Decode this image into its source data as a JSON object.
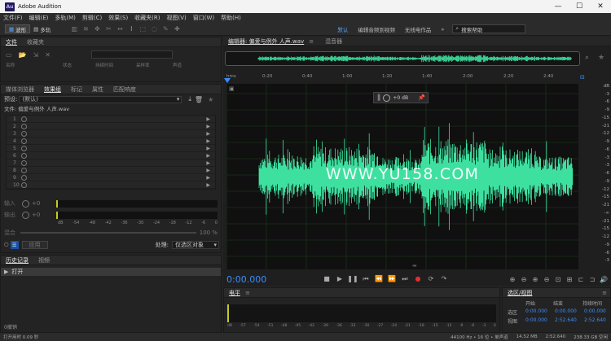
{
  "window": {
    "title": "Adobe Audition",
    "logo": "Au",
    "min": "—",
    "max": "☐",
    "close": "✕"
  },
  "menu": [
    "文件(F)",
    "编辑(E)",
    "多轨(M)",
    "剪辑(C)",
    "效果(S)",
    "收藏夹(R)",
    "视图(V)",
    "窗口(W)",
    "帮助(H)"
  ],
  "toolbar": {
    "waveform": "波形",
    "multitrack": "多轨",
    "workspaces": [
      "默认",
      "编辑音频到视频",
      "无线电作品"
    ],
    "more": "»",
    "search_placeholder": "搜索帮助"
  },
  "files_panel": {
    "tabs": [
      "文件",
      "收藏夹"
    ],
    "cols": [
      "名称",
      "状态",
      "持续时间",
      "采样率",
      "声道"
    ]
  },
  "effects_panel": {
    "tabs": [
      "媒体浏览器",
      "效果组",
      "标记",
      "属性",
      "匹配响度"
    ],
    "preset_label": "预设:",
    "preset_value": "(默认)",
    "file_label": "文件: 偏爱与例外 人声.wav",
    "rows": [
      "1",
      "2",
      "3",
      "4",
      "5",
      "6",
      "7",
      "8",
      "9",
      "10"
    ],
    "input_label": "输入",
    "output_label": "输出",
    "input_db": "+0",
    "output_db": "+0",
    "meter_ticks": [
      "dB",
      "-54",
      "-48",
      "-42",
      "-36",
      "-30",
      "-24",
      "-18",
      "-12",
      "-6",
      "0"
    ],
    "mix_label": "混合",
    "mix_pct": "100 %",
    "apply_label": "应用",
    "process_label": "处理:",
    "process_value": "仅选区对象"
  },
  "history_panel": {
    "tabs": [
      "历史记录",
      "视频"
    ],
    "item": "打开",
    "undo_count": "0撤销"
  },
  "editor": {
    "tabs": [
      "编辑器: 偏爱与例外 人声.wav",
      "混音器"
    ],
    "ruler": [
      "hms",
      "0:20",
      "0:40",
      "1:00",
      "1:20",
      "1:40",
      "2:00",
      "2:20",
      "2:40"
    ],
    "db_scale": [
      "dB",
      "-3",
      "-6",
      "-9",
      "-15",
      "-21",
      "-12",
      "-9",
      "-6",
      "-3",
      "-3",
      "-6",
      "-9",
      "-12",
      "-15",
      "-21",
      "-∞",
      "-21",
      "-15",
      "-12",
      "-9",
      "-6",
      "-3"
    ],
    "hud_db": "+0 dB",
    "watermark": "WWW.YU158.COM",
    "time": "0:00.000"
  },
  "level_panel": {
    "title": "电平",
    "ticks": [
      "dB",
      "-57",
      "-54",
      "-51",
      "-48",
      "-45",
      "-42",
      "-39",
      "-36",
      "-33",
      "-30",
      "-27",
      "-24",
      "-21",
      "-18",
      "-15",
      "-12",
      "-9",
      "-6",
      "-3",
      "0"
    ]
  },
  "selection_panel": {
    "title": "选区/视图",
    "cols": [
      "开始",
      "结束",
      "持续时间"
    ],
    "rows": [
      {
        "label": "选区",
        "v": [
          "0:00.000",
          "0:00.000",
          "0:00.000"
        ]
      },
      {
        "label": "视图",
        "v": [
          "0:00.000",
          "2:52.640",
          "2:52.640"
        ]
      }
    ]
  },
  "status": {
    "left": "打开用时 0.09 秒",
    "rate": "44100 Hz • 16 位 • 单声道",
    "size": "14.52 MB",
    "dur": "2:52.640",
    "free": "238.33 GB 空闲"
  },
  "colors": {
    "wave": "#3ee0a0",
    "accent": "#3a8cff",
    "time": "#3a8cff"
  }
}
